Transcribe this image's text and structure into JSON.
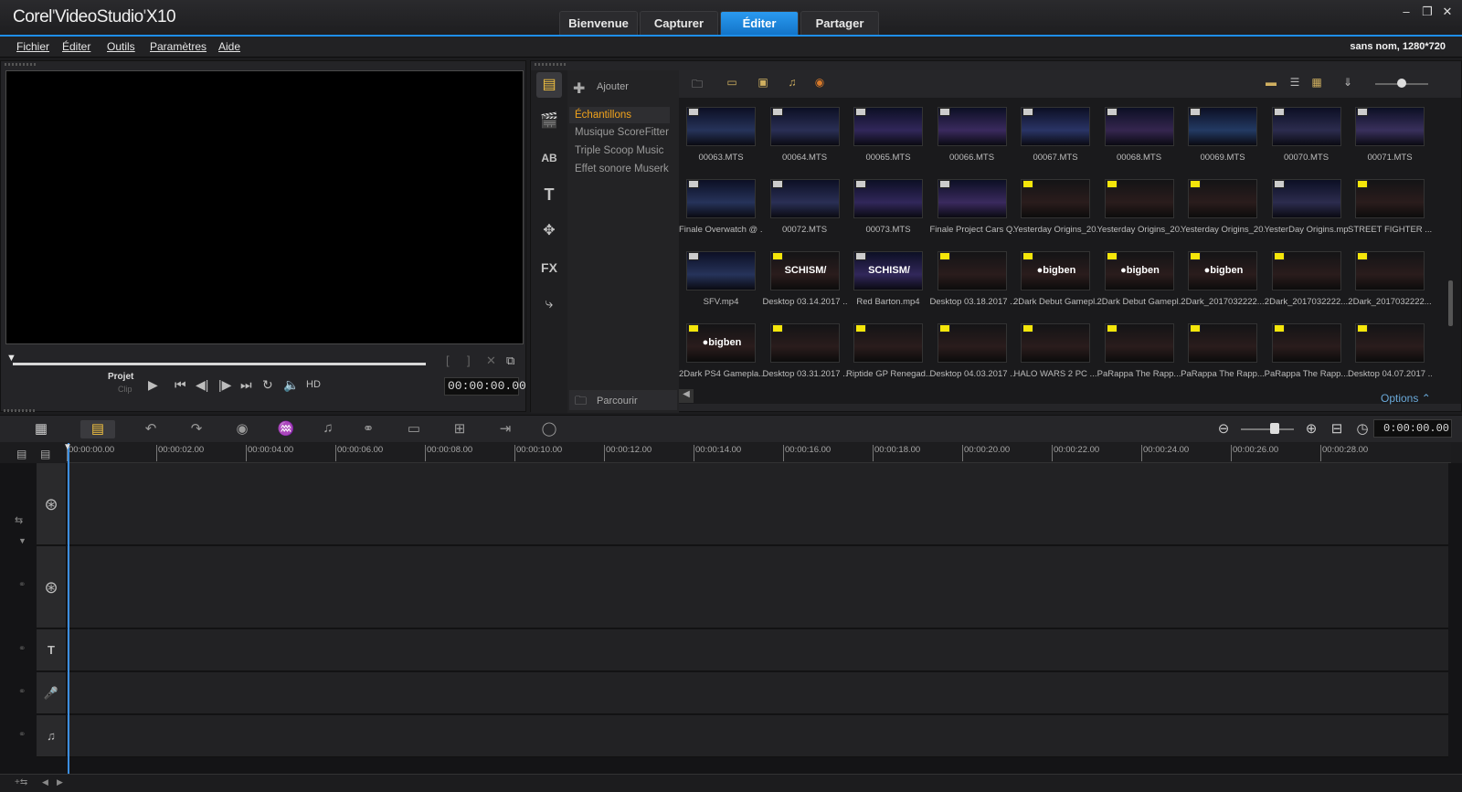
{
  "app": {
    "brand_a": "Corel",
    "brand_b": "VideoStudio",
    "brand_c": "X10"
  },
  "tabs": [
    {
      "label": "Bienvenue"
    },
    {
      "label": "Capturer"
    },
    {
      "label": "Éditer"
    },
    {
      "label": "Partager"
    }
  ],
  "menu": [
    {
      "label": "Fichier"
    },
    {
      "label": "Éditer"
    },
    {
      "label": "Outils"
    },
    {
      "label": "Paramètres"
    },
    {
      "label": "Aide"
    }
  ],
  "project_info": "sans nom, 1280*720",
  "player": {
    "mode_project": "Projet",
    "mode_clip": "Clip",
    "hd": "HD",
    "timecode": "00:00:00.00"
  },
  "library": {
    "add_label": "Ajouter",
    "browse_label": "Parcourir",
    "options_label": "Options",
    "folders": [
      {
        "label": "Échantillons"
      },
      {
        "label": "Musique ScoreFitter"
      },
      {
        "label": "Triple Scoop Music"
      },
      {
        "label": "Effet sonore Muserk"
      }
    ],
    "items": [
      {
        "name": "00063.MTS",
        "type": "video"
      },
      {
        "name": "00064.MTS",
        "type": "video"
      },
      {
        "name": "00065.MTS",
        "type": "video"
      },
      {
        "name": "00066.MTS",
        "type": "video"
      },
      {
        "name": "00067.MTS",
        "type": "video"
      },
      {
        "name": "00068.MTS",
        "type": "video"
      },
      {
        "name": "00069.MTS",
        "type": "video"
      },
      {
        "name": "00070.MTS",
        "type": "video"
      },
      {
        "name": "00071.MTS",
        "type": "video"
      },
      {
        "name": "Finale Overwatch @ ...",
        "type": "video"
      },
      {
        "name": "00072.MTS",
        "type": "video"
      },
      {
        "name": "00073.MTS",
        "type": "video"
      },
      {
        "name": "Finale Project Cars Q...",
        "type": "video"
      },
      {
        "name": "Yesterday Origins_20...",
        "type": "game"
      },
      {
        "name": "Yesterday Origins_20...",
        "type": "game"
      },
      {
        "name": "Yesterday Origins_20...",
        "type": "game"
      },
      {
        "name": "YesterDay Origins.mp4",
        "type": "video"
      },
      {
        "name": "STREET FIGHTER ...",
        "type": "game"
      },
      {
        "name": "SFV.mp4",
        "type": "video"
      },
      {
        "name": "Desktop 03.14.2017 ...",
        "type": "game",
        "text": "SCHISM/"
      },
      {
        "name": "Red Barton.mp4",
        "type": "video",
        "text": "SCHISM/"
      },
      {
        "name": "Desktop 03.18.2017 ...",
        "type": "game"
      },
      {
        "name": "2Dark Debut Gamepl...",
        "type": "game",
        "text": "●bigben"
      },
      {
        "name": "2Dark Debut Gamepl...",
        "type": "game",
        "text": "●bigben"
      },
      {
        "name": "2Dark_2017032222...",
        "type": "game",
        "text": "●bigben"
      },
      {
        "name": "2Dark_2017032222...",
        "type": "game"
      },
      {
        "name": "2Dark_2017032222...",
        "type": "game"
      },
      {
        "name": "2Dark PS4 Gamepla...",
        "type": "game",
        "text": "●bigben"
      },
      {
        "name": "Desktop 03.31.2017 ...",
        "type": "game"
      },
      {
        "name": "Riptide GP Renegad...",
        "type": "game"
      },
      {
        "name": "Desktop 04.03.2017 ...",
        "type": "game"
      },
      {
        "name": "HALO WARS 2 PC ...",
        "type": "game"
      },
      {
        "name": "PaRappa The Rapp...",
        "type": "game"
      },
      {
        "name": "PaRappa The Rapp...",
        "type": "game"
      },
      {
        "name": "PaRappa The Rapp...",
        "type": "game"
      },
      {
        "name": "Desktop 04.07.2017 ...",
        "type": "game"
      }
    ]
  },
  "timeline": {
    "timecode": "0:00:00.00",
    "ticks": [
      "00:00:00.00",
      "00:00:02.00",
      "00:00:04.00",
      "00:00:06.00",
      "00:00:08.00",
      "00:00:10.00",
      "00:00:12.00",
      "00:00:14.00",
      "00:00:16.00",
      "00:00:18.00",
      "00:00:20.00",
      "00:00:22.00",
      "00:00:24.00",
      "00:00:26.00",
      "00:00:28.00"
    ]
  }
}
